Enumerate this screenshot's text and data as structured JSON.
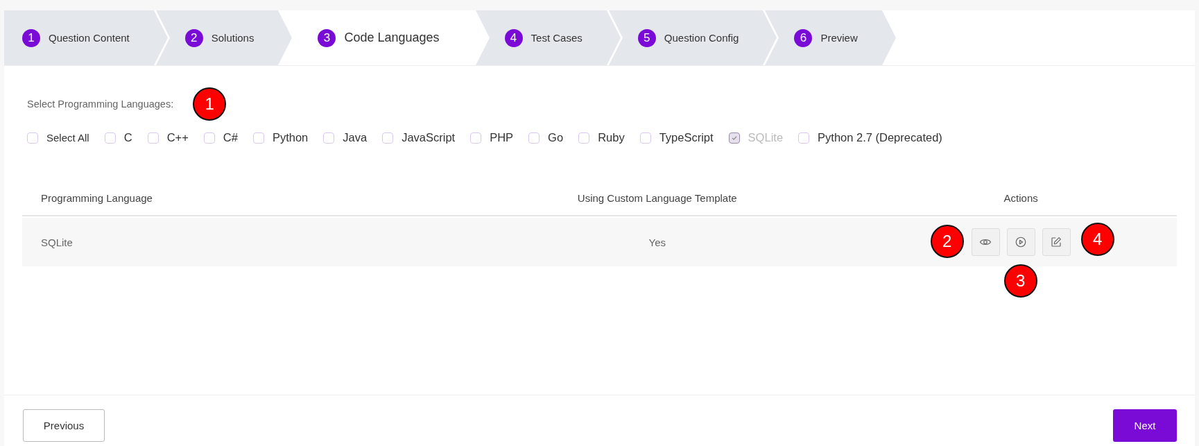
{
  "steps": [
    {
      "number": "1",
      "label": "Question Content",
      "selected": false
    },
    {
      "number": "2",
      "label": "Solutions",
      "selected": false
    },
    {
      "number": "3",
      "label": "Code Languages",
      "selected": true
    },
    {
      "number": "4",
      "label": "Test Cases",
      "selected": false
    },
    {
      "number": "5",
      "label": "Question Config",
      "selected": false
    },
    {
      "number": "6",
      "label": "Preview",
      "selected": false
    }
  ],
  "languages_label": "Select Programming Languages:",
  "languages_callout": "1",
  "languages": [
    {
      "label": "Select All",
      "checked": false,
      "disabled": false
    },
    {
      "label": "C",
      "checked": false,
      "disabled": false
    },
    {
      "label": "C++",
      "checked": false,
      "disabled": false
    },
    {
      "label": "C#",
      "checked": false,
      "disabled": false
    },
    {
      "label": "Python",
      "checked": false,
      "disabled": false
    },
    {
      "label": "Java",
      "checked": false,
      "disabled": false
    },
    {
      "label": "JavaScript",
      "checked": false,
      "disabled": false
    },
    {
      "label": "PHP",
      "checked": false,
      "disabled": false
    },
    {
      "label": "Go",
      "checked": false,
      "disabled": false
    },
    {
      "label": "Ruby",
      "checked": false,
      "disabled": false
    },
    {
      "label": "TypeScript",
      "checked": false,
      "disabled": false
    },
    {
      "label": "SQLite",
      "checked": true,
      "disabled": true
    },
    {
      "label": "Python 2.7 (Deprecated)",
      "checked": false,
      "disabled": false
    }
  ],
  "table": {
    "columns": [
      "Programming Language",
      "Using Custom Language Template",
      "Actions"
    ],
    "rows": [
      {
        "language": "SQLite",
        "custom_template": "Yes",
        "actions": [
          {
            "kind": "view",
            "callout": "2"
          },
          {
            "kind": "run",
            "callout": "3"
          },
          {
            "kind": "edit",
            "callout": "4"
          }
        ]
      }
    ]
  },
  "buttons": {
    "previous": "Previous",
    "next": "Next"
  }
}
